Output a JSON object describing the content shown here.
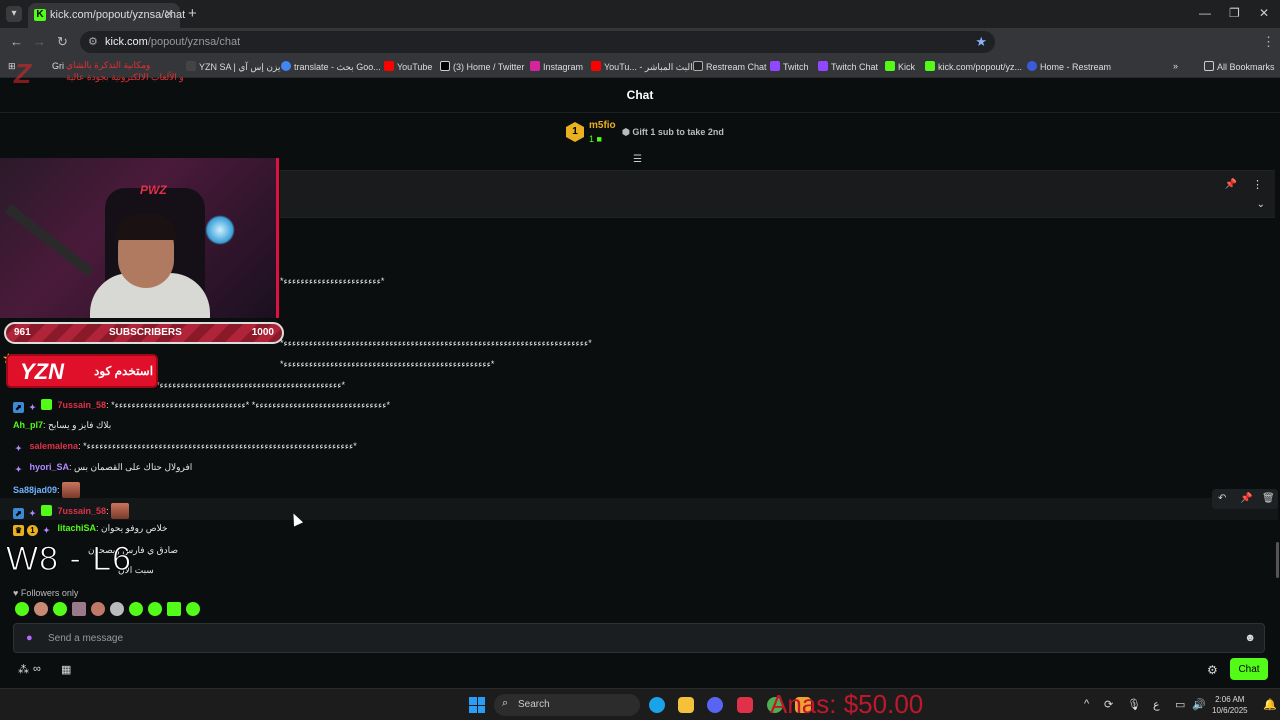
{
  "browser": {
    "tab_title": "kick.com/popout/yznsa/chat",
    "url_host": "kick.com",
    "url_path": "/popout/yznsa/chat",
    "bookmarks": [
      {
        "label": "Gri",
        "color": "#888"
      },
      {
        "label": "YZN SA | يزن إس آي",
        "color": "#444"
      },
      {
        "label": "translate - بحث Goo...",
        "color": "#4285f4"
      },
      {
        "label": "YouTube",
        "color": "#ff0000"
      },
      {
        "label": "(3) Home / Twitter",
        "color": "#000"
      },
      {
        "label": "Instagram",
        "color": "#d6249f"
      },
      {
        "label": "YouTu... - البث المباشر",
        "color": "#ff0000"
      },
      {
        "label": "Restream Chat",
        "color": "#222"
      },
      {
        "label": "Twitch",
        "color": "#9146ff"
      },
      {
        "label": "Twitch Chat",
        "color": "#9146ff"
      },
      {
        "label": "Kick",
        "color": "#53fc18"
      },
      {
        "label": "kick.com/popout/yz...",
        "color": "#53fc18"
      },
      {
        "label": "Home - Restream",
        "color": "#3b5bdb"
      }
    ],
    "all_bookmarks": "All Bookmarks"
  },
  "chat": {
    "title": "Chat",
    "top_gifter": {
      "name": "m5fio",
      "rank": "1",
      "count": "1"
    },
    "gift_cta": "Gift 1 sub to take 2nd",
    "messages": [
      {
        "user": "7ussain_58",
        "user_color": "#e0304a",
        "sep": ": ",
        "text": "*ﺀﺀﺀﺀﺀﺀﺀﺀﺀﺀﺀﺀﺀﺀﺀﺀﺀﺀﺀﺀﺀﺀﺀﺀﺀﺀﺀﺀﺀﺀﺀ* *ﺀﺀﺀﺀﺀﺀﺀﺀﺀﺀﺀﺀﺀﺀﺀﺀﺀﺀﺀﺀﺀﺀﺀﺀﺀﺀﺀﺀﺀﺀﺀ*"
      },
      {
        "user": "Ah_pl7",
        "user_color": "#53fc18",
        "sep": ": ",
        "text": "بلاك فايز و يسابح"
      },
      {
        "user": "salemalena",
        "user_color": "#e0304a",
        "sep": ": ",
        "text": "*ﺀﺀﺀﺀﺀﺀﺀﺀﺀﺀﺀﺀﺀﺀﺀﺀﺀﺀﺀﺀﺀﺀﺀﺀﺀﺀﺀﺀﺀﺀﺀﺀﺀﺀﺀﺀﺀﺀﺀﺀﺀﺀﺀﺀﺀﺀﺀﺀﺀﺀﺀﺀﺀﺀﺀﺀﺀﺀﺀﺀﺀﺀﺀ*"
      },
      {
        "user": "hyori_SA",
        "user_color": "#b18cff",
        "sep": ": ",
        "text": "افرولال حتاك على القصمان بس"
      },
      {
        "user": "Sa88jad09",
        "user_color": "#6fb3ff",
        "sep": ":",
        "text": ""
      },
      {
        "user": "7ussain_58",
        "user_color": "#e0304a",
        "sep": ":",
        "text": ""
      },
      {
        "user": "litachiSA",
        "user_color": "#53fc18",
        "sep": ": ",
        "text": "خلاص روفو يحوان"
      }
    ],
    "stray_lines": [
      "*ﺀﺀﺀﺀﺀﺀﺀﺀﺀﺀﺀﺀﺀﺀﺀﺀﺀﺀﺀﺀﺀﺀﺀ*",
      "*ﺀﺀﺀﺀﺀﺀﺀﺀﺀﺀﺀﺀﺀﺀﺀﺀﺀﺀﺀﺀﺀﺀﺀﺀﺀﺀﺀﺀﺀﺀﺀﺀﺀﺀﺀﺀﺀﺀﺀﺀﺀﺀﺀﺀﺀﺀﺀﺀﺀﺀﺀﺀﺀﺀﺀﺀﺀﺀﺀﺀﺀﺀﺀﺀﺀﺀﺀﺀﺀﺀﺀﺀ*",
      "*ﺀﺀﺀﺀﺀﺀﺀﺀﺀﺀﺀﺀﺀﺀﺀﺀﺀﺀﺀﺀﺀﺀﺀﺀﺀﺀﺀﺀﺀﺀﺀﺀﺀﺀﺀﺀﺀﺀﺀﺀﺀﺀﺀﺀﺀﺀﺀﺀﺀ*",
      "*ﺀﺀﺀﺀﺀﺀﺀﺀﺀﺀﺀﺀﺀﺀﺀﺀﺀﺀﺀﺀﺀﺀﺀﺀﺀﺀﺀﺀﺀﺀﺀﺀﺀﺀﺀﺀﺀﺀﺀﺀﺀﺀﺀ*",
      "صادق ي فارس ويصحون",
      "سبت الان"
    ],
    "followers_only": "Followers only",
    "input_placeholder": "Send a message",
    "send_label": "Chat"
  },
  "overlay": {
    "subs_current": "961",
    "subs_label": "SUBSCRIBERS",
    "subs_goal": "1000",
    "subs_progress": 0.961,
    "promo_code": "YZN",
    "promo_text": "استخدم كود",
    "record": "W8 - L6",
    "promo_header_line1": "ومكانية التذكرة بالشاي",
    "promo_header_line2": "و الألعاب الالكترونية بجودة عالية",
    "donation": "Anas: $50.00"
  },
  "taskbar": {
    "search_label": "Search",
    "lang": "ع",
    "time": "2:06 AM",
    "date": "10/6/2025"
  },
  "colors": {
    "kick_green": "#53fc18",
    "gifter_gold": "#e9b021",
    "overlay_red": "#e0102a"
  }
}
